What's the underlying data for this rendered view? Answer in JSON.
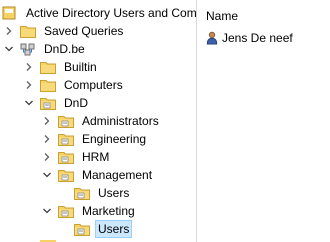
{
  "tree": {
    "root": "Active Directory Users and Com",
    "saved_queries": "Saved Queries",
    "domain": "DnD.be",
    "builtin": "Builtin",
    "computers": "Computers",
    "dnd": "DnD",
    "administrators": "Administrators",
    "engineering": "Engineering",
    "hrm": "HRM",
    "management": "Management",
    "management_users": "Users",
    "marketing": "Marketing",
    "marketing_users": "Users"
  },
  "list": {
    "header_name": "Name",
    "items": [
      "Jens De neef"
    ]
  },
  "colors": {
    "selection": "#cce8ff",
    "folder": "#f3c44e"
  },
  "icons": [
    "ad-console-icon",
    "saved-queries-folder-icon",
    "domain-icon",
    "folder-icon",
    "ou-icon",
    "user-icon",
    "chevron-right-icon",
    "chevron-down-icon"
  ]
}
